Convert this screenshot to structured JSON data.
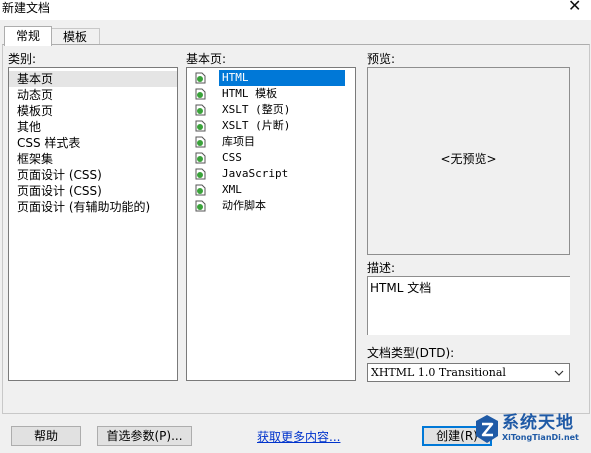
{
  "window": {
    "title": "新建文档"
  },
  "tabs": [
    {
      "label": "常规",
      "active": true
    },
    {
      "label": "模板",
      "active": false
    }
  ],
  "category": {
    "label": "类别:",
    "items": [
      "基本页",
      "动态页",
      "模板页",
      "其他",
      "CSS 样式表",
      "框架集",
      "页面设计 (CSS)",
      "页面设计 (CSS)",
      "页面设计 (有辅助功能的)"
    ],
    "selected_index": 0
  },
  "basic_page": {
    "label": "基本页:",
    "items": [
      "HTML",
      "HTML 模板",
      "XSLT (整页)",
      "XSLT (片断)",
      "库项目",
      "CSS",
      "JavaScript",
      "XML",
      "动作脚本"
    ],
    "selected_index": 0
  },
  "preview": {
    "label": "预览:",
    "text": "<无预览>"
  },
  "description": {
    "label": "描述:",
    "text": "HTML 文档"
  },
  "doctype": {
    "label": "文档类型(DTD):",
    "value": "XHTML 1.0 Transitional"
  },
  "buttons": {
    "help": "帮助",
    "prefs": "首选参数(P)...",
    "more": "获取更多内容...",
    "create": "创建(R)"
  },
  "watermark": {
    "line1": "系统天地",
    "line2": "XiTongTianDi.net"
  },
  "colors": {
    "selection_blue": "#0078d7",
    "selection_gray": "#e5e5e5",
    "link": "#0033cc",
    "logo": "#1f5aa6"
  }
}
